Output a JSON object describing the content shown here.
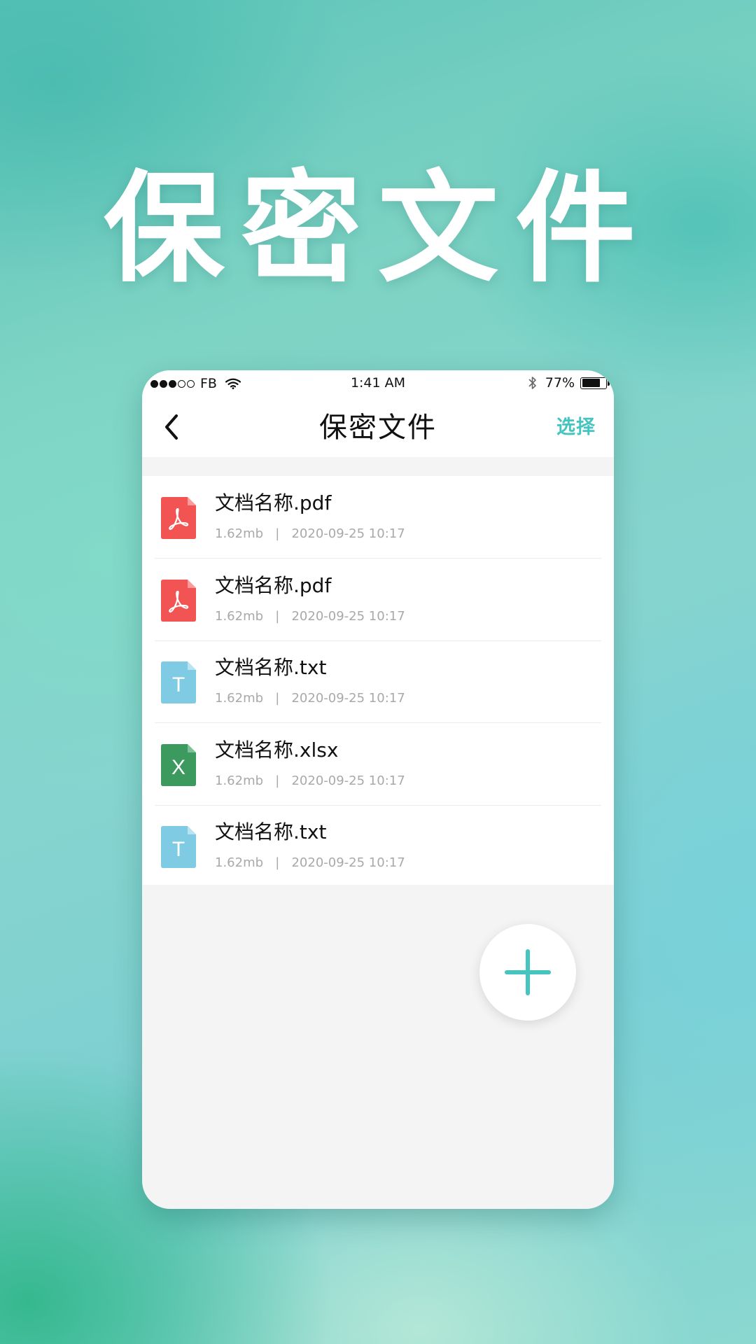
{
  "hero": {
    "title": "保密文件"
  },
  "status_bar": {
    "carrier": "FB",
    "time": "1:41 AM",
    "battery_percent": "77%",
    "battery_level": 0.77
  },
  "nav": {
    "title": "保密文件",
    "select_label": "选择"
  },
  "colors": {
    "accent": "#45c4c0",
    "pdf": "#f25454",
    "txt": "#7ecbe3",
    "xlsx": "#3c9a5f"
  },
  "files": [
    {
      "name": "文档名称.pdf",
      "size": "1.62mb",
      "separator": "|",
      "date": "2020-09-25 10:17",
      "type": "pdf",
      "icon": "pdf-file-icon"
    },
    {
      "name": "文档名称.pdf",
      "size": "1.62mb",
      "separator": "|",
      "date": "2020-09-25 10:17",
      "type": "pdf",
      "icon": "pdf-file-icon"
    },
    {
      "name": "文档名称.txt",
      "size": "1.62mb",
      "separator": "|",
      "date": "2020-09-25 10:17",
      "type": "txt",
      "icon": "txt-file-icon",
      "glyph": "T"
    },
    {
      "name": "文档名称.xlsx",
      "size": "1.62mb",
      "separator": "|",
      "date": "2020-09-25 10:17",
      "type": "xlsx",
      "icon": "excel-file-icon",
      "glyph": "X"
    },
    {
      "name": "文档名称.txt",
      "size": "1.62mb",
      "separator": "|",
      "date": "2020-09-25 10:17",
      "type": "txt",
      "icon": "txt-file-icon",
      "glyph": "T"
    }
  ],
  "fab": {
    "icon": "plus-icon"
  }
}
